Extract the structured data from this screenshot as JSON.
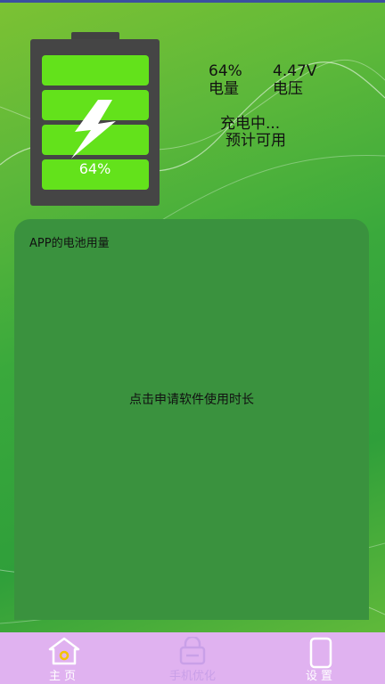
{
  "battery": {
    "level_text": "64%",
    "level_fraction": 0.64
  },
  "stats": {
    "level_value": "64%",
    "level_label": "电量",
    "voltage_value": "4.47V",
    "voltage_label": "电压"
  },
  "status": {
    "charging": "充电中...",
    "estimate": "预计可用"
  },
  "usage_card": {
    "title": "APP的电池用量",
    "action": "点击申请软件使用时长"
  },
  "nav": {
    "items": [
      {
        "label": "主页",
        "icon": "home-icon"
      },
      {
        "label": "手机优化",
        "icon": "optimize-icon",
        "active": true
      },
      {
        "label": "设置",
        "icon": "phone-settings-icon"
      }
    ]
  },
  "colors": {
    "battery_cell": "#63e21b",
    "battery_body": "#454545",
    "card": "#3a923e",
    "nav_bar": "#e0b2f0"
  }
}
